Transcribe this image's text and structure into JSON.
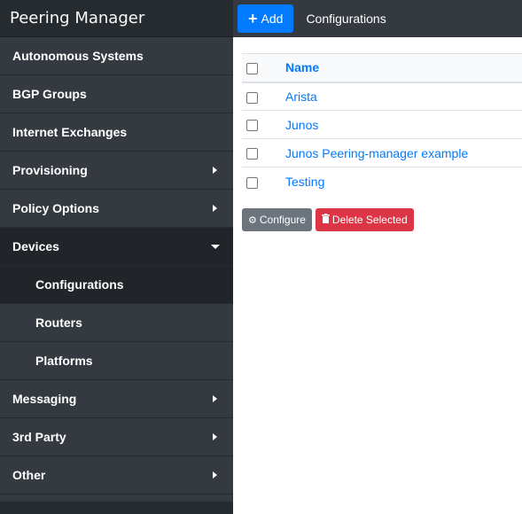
{
  "brand": "Peering Manager",
  "topbar": {
    "add_label": "Add",
    "title": "Configurations"
  },
  "sidebar": {
    "items": [
      {
        "label": "Autonomous Systems"
      },
      {
        "label": "BGP Groups"
      },
      {
        "label": "Internet Exchanges"
      },
      {
        "label": "Provisioning"
      },
      {
        "label": "Policy Options"
      },
      {
        "label": "Devices"
      },
      {
        "label": "Messaging"
      },
      {
        "label": "3rd Party"
      },
      {
        "label": "Other"
      }
    ],
    "devices_sub": [
      {
        "label": "Configurations"
      },
      {
        "label": "Routers"
      },
      {
        "label": "Platforms"
      }
    ]
  },
  "table": {
    "header_name": "Name",
    "rows": [
      {
        "name": "Arista"
      },
      {
        "name": "Junos"
      },
      {
        "name": "Junos Peering-manager example"
      },
      {
        "name": "Testing"
      }
    ]
  },
  "actions": {
    "configure": "Configure",
    "delete": "Delete Selected"
  },
  "colors": {
    "sidebar_bg": "#343a40",
    "primary": "#007bff",
    "danger": "#dc3545",
    "secondary": "#6c757d"
  }
}
